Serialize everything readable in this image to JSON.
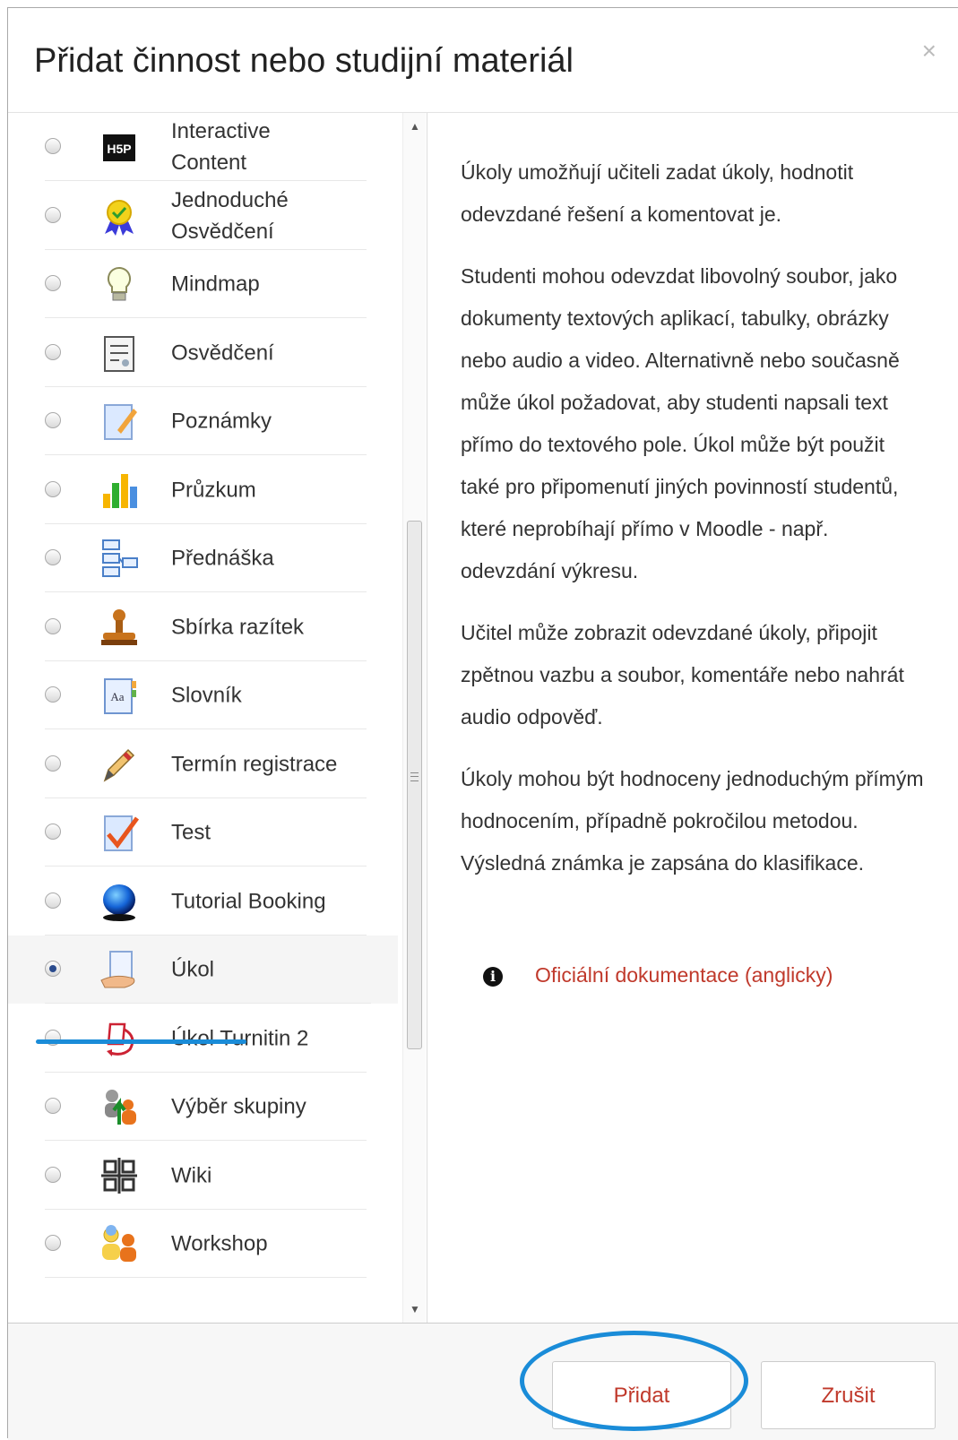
{
  "dialog": {
    "title": "Přidat činnost nebo studijní materiál",
    "close_symbol": "×"
  },
  "activities": [
    {
      "label": "Interactive Content",
      "icon": "h5p-icon",
      "selected": false
    },
    {
      "label": "Jednoduché Osvědčení",
      "icon": "certificate-badge-icon",
      "selected": false
    },
    {
      "label": "Mindmap",
      "icon": "lightbulb-icon",
      "selected": false
    },
    {
      "label": "Osvědčení",
      "icon": "certificate-document-icon",
      "selected": false
    },
    {
      "label": "Poznámky",
      "icon": "notes-pencil-icon",
      "selected": false
    },
    {
      "label": "Průzkum",
      "icon": "bar-chart-icon",
      "selected": false
    },
    {
      "label": "Přednáška",
      "icon": "lesson-flowchart-icon",
      "selected": false
    },
    {
      "label": "Sbírka razítek",
      "icon": "stamp-icon",
      "selected": false
    },
    {
      "label": "Slovník",
      "icon": "glossary-book-icon",
      "selected": false
    },
    {
      "label": "Termín registrace",
      "icon": "pen-icon",
      "selected": false
    },
    {
      "label": "Test",
      "icon": "quiz-checkmark-icon",
      "selected": false
    },
    {
      "label": "Tutorial Booking",
      "icon": "globe-icon",
      "selected": false
    },
    {
      "label": "Úkol",
      "icon": "assignment-hand-icon",
      "selected": true
    },
    {
      "label": "Úkol Turnitin 2",
      "icon": "turnitin-icon",
      "selected": false
    },
    {
      "label": "Výběr skupiny",
      "icon": "group-choice-icon",
      "selected": false
    },
    {
      "label": "Wiki",
      "icon": "wiki-icon",
      "selected": false
    },
    {
      "label": "Workshop",
      "icon": "workshop-people-icon",
      "selected": false
    }
  ],
  "description": {
    "paragraphs": [
      "Úkoly umožňují učiteli zadat úkoly, hodnotit odevzdané řešení a komentovat je.",
      "Studenti mohou odevzdat libovolný soubor, jako dokumenty textových aplikací, tabulky, obrázky nebo audio a video. Alternativně nebo současně může úkol požadovat, aby studenti napsali text přímo do textového pole. Úkol může být použit také pro připomenutí jiných povinností studentů, které neprobíhají přímo v Moodle - např. odevzdání výkresu.",
      "Učitel může zobrazit odevzdané úkoly, připojit zpětnou vazbu a soubor, komentáře nebo nahrát audio odpověď.",
      "Úkoly mohou být hodnoceny jednoduchým přímým hodnocením, případně pokročilou metodou. Výsledná známka je zapsána do klasifikace."
    ],
    "doc_link": "Oficiální dokumentace (anglicky)",
    "info_icon": "info-icon"
  },
  "footer": {
    "add_label": "Přidat",
    "cancel_label": "Zrušit"
  },
  "colors": {
    "link": "#c0392b",
    "annotation": "#1a8cd8",
    "radio_selected": "#2a4b8d"
  }
}
